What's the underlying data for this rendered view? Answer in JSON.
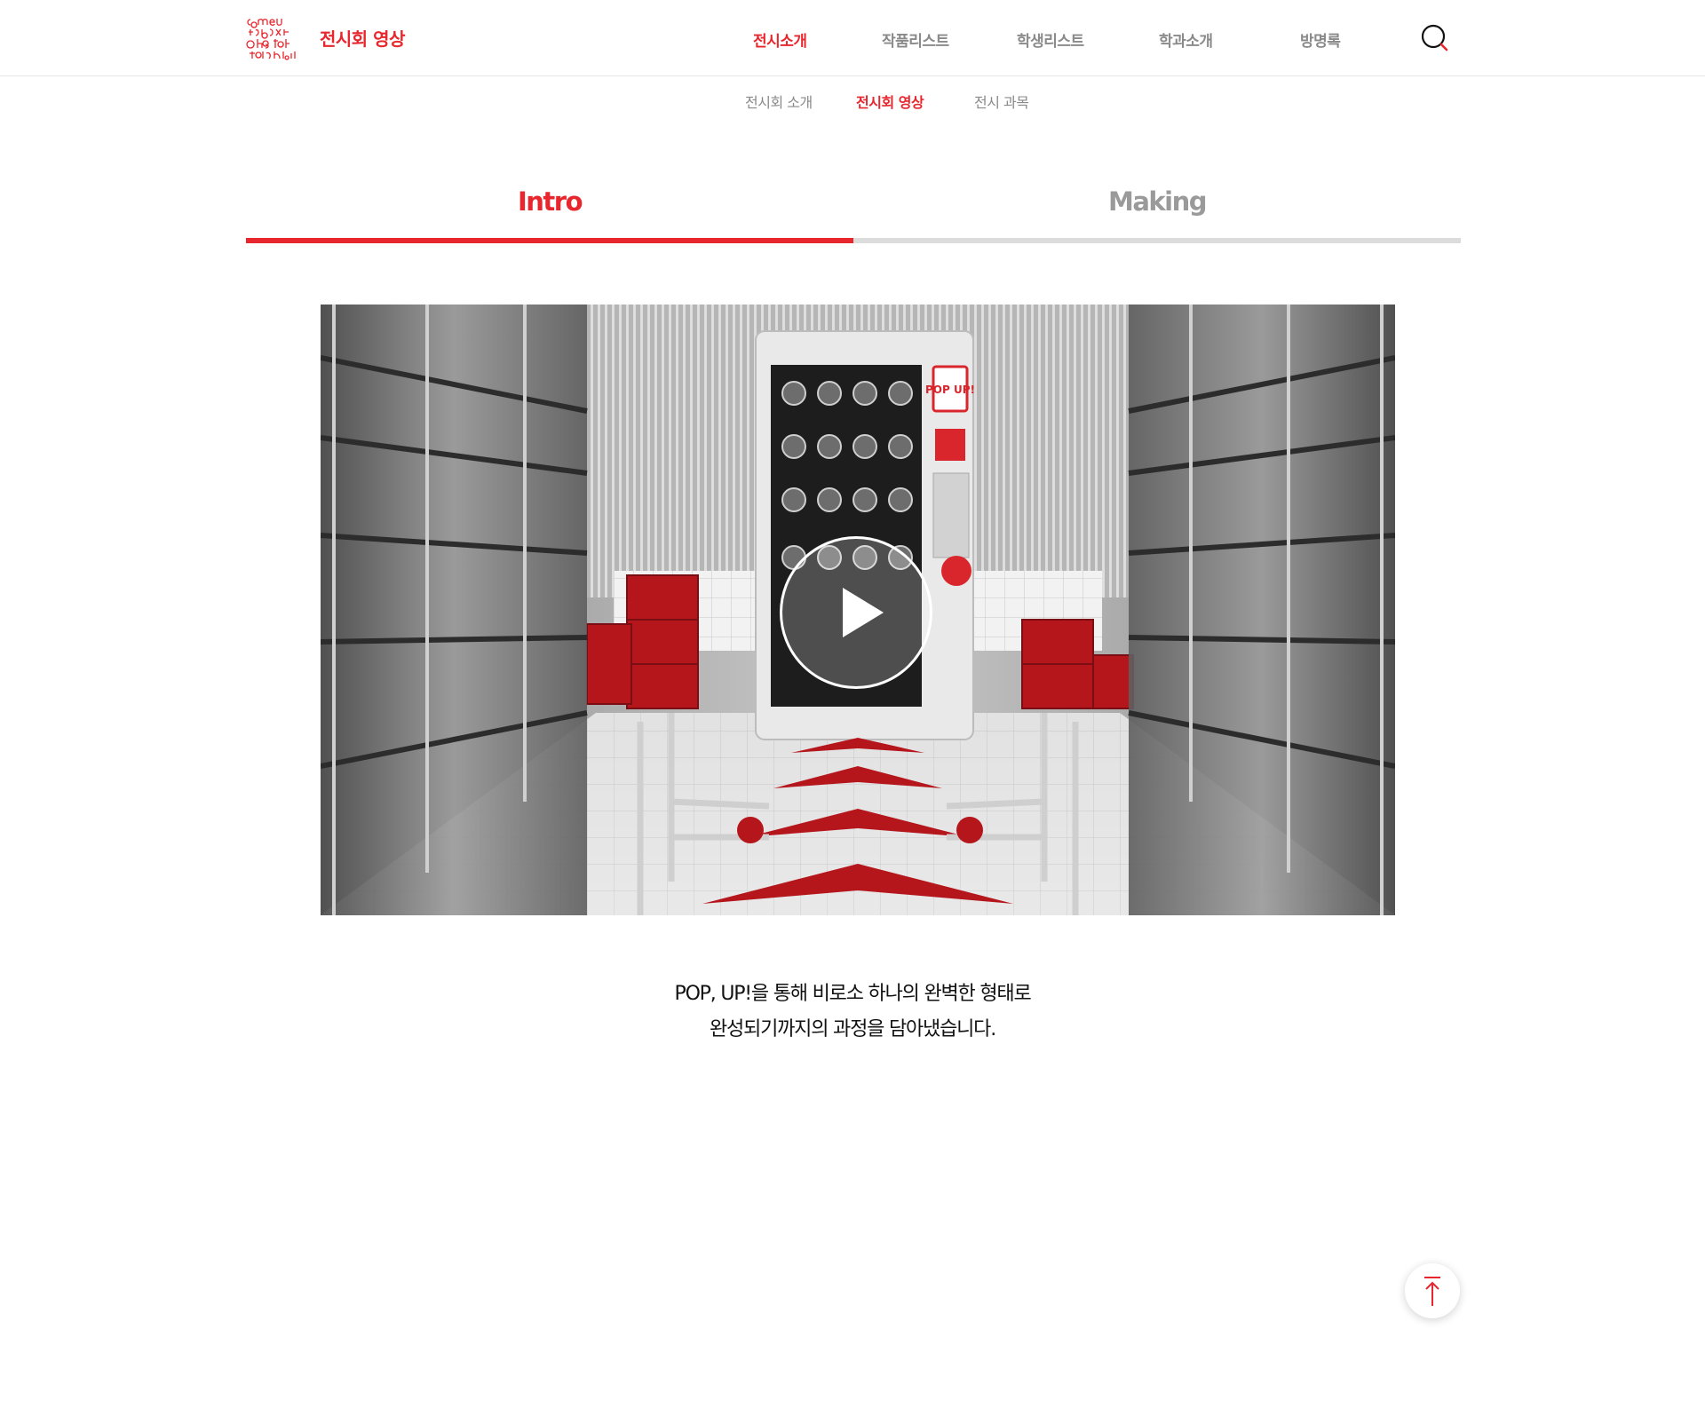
{
  "header": {
    "logo_text": "comEunicatin design",
    "page_label": "전시회 영상",
    "nav": [
      {
        "label": "전시소개",
        "active": true
      },
      {
        "label": "작품리스트",
        "active": false
      },
      {
        "label": "학생리스트",
        "active": false
      },
      {
        "label": "학과소개",
        "active": false
      },
      {
        "label": "방명록",
        "active": false
      }
    ],
    "search_icon": "search-icon"
  },
  "subnav": [
    {
      "label": "전시회 소개",
      "active": false
    },
    {
      "label": "전시회 영상",
      "active": true
    },
    {
      "label": "전시 과목",
      "active": false
    }
  ],
  "tabs": [
    {
      "label": "Intro",
      "active": true
    },
    {
      "label": "Making",
      "active": false
    }
  ],
  "video": {
    "play_icon": "play-icon",
    "poster_sign": "POP UP!"
  },
  "description": {
    "line1": "POP, UP!을 통해 비로소 하나의 완벽한 형태로",
    "line2": "완성되기까지의 과정을 담아냈습니다."
  },
  "top_button": {
    "icon": "arrow-up-icon"
  },
  "colors": {
    "accent": "#e8262d",
    "inactive": "#9a9a9a",
    "tab_track": "#dcdcdc"
  }
}
